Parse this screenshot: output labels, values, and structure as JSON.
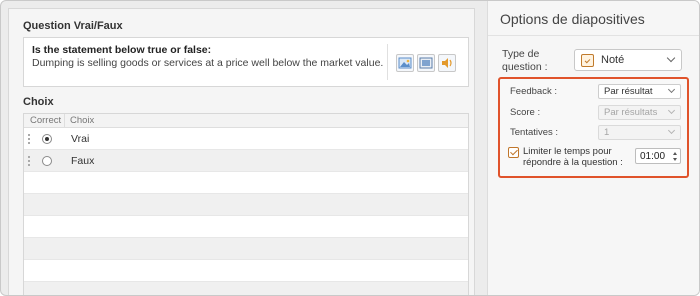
{
  "editor": {
    "question_section_title": "Question Vrai/Faux",
    "question_bold": "Is the statement below true or false:",
    "question_text": "Dumping is selling goods or services at a price well below the market value.",
    "media_buttons": [
      "image-icon",
      "video-icon",
      "audio-icon"
    ],
    "choices_section_title": "Choix",
    "columns": [
      "Correct",
      "Choix"
    ],
    "choices": [
      {
        "label": "Vrai",
        "correct": true
      },
      {
        "label": "Faux",
        "correct": false
      }
    ]
  },
  "options": {
    "title": "Options de diapositives",
    "question_type_label": "Type de question :",
    "question_type_value": "Noté",
    "feedback_label": "Feedback :",
    "feedback_value": "Par résultat",
    "score_label": "Score :",
    "score_value": "Par résultats",
    "attempts_label": "Tentatives :",
    "attempts_value": "1",
    "limit_time_label": "Limiter le temps pour répondre à la question :",
    "limit_time_checked": true,
    "time_value": "01:00",
    "highlight_color": "#e0532b"
  }
}
